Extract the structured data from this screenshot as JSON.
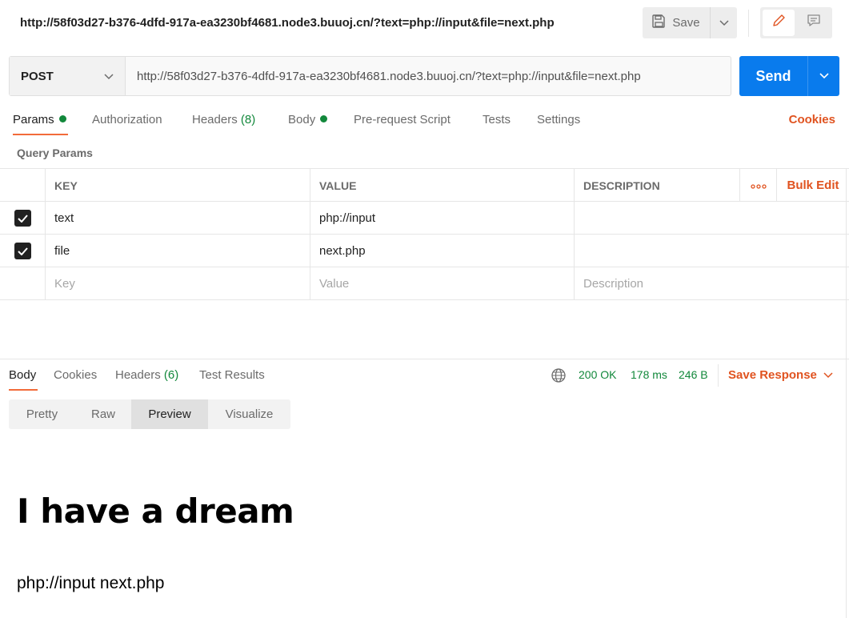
{
  "title_bar": {
    "url": "http://58f03d27-b376-4dfd-917a-ea3230bf4681.node3.buuoj.cn/?text=php://input&file=next.php",
    "save_label": "Save",
    "icons": [
      "save-icon",
      "chevron-down-icon",
      "pencil-icon",
      "comment-icon"
    ]
  },
  "request": {
    "method": "POST",
    "url": "http://58f03d27-b376-4dfd-917a-ea3230bf4681.node3.buuoj.cn/?text=php://input&file=next.php",
    "send_label": "Send"
  },
  "request_tabs": {
    "params": "Params",
    "authorization": "Authorization",
    "headers": "Headers",
    "headers_count": "(8)",
    "body": "Body",
    "pre_request": "Pre-request Script",
    "tests": "Tests",
    "settings": "Settings",
    "cookies": "Cookies"
  },
  "query_params": {
    "label": "Query Params",
    "columns": {
      "key": "KEY",
      "value": "VALUE",
      "description": "DESCRIPTION",
      "bulk_edit": "Bulk Edit"
    },
    "rows": [
      {
        "checked": true,
        "key": "text",
        "value": "php://input",
        "description": ""
      },
      {
        "checked": true,
        "key": "file",
        "value": "next.php",
        "description": ""
      }
    ],
    "placeholders": {
      "key": "Key",
      "value": "Value",
      "description": "Description"
    }
  },
  "response": {
    "tabs": {
      "body": "Body",
      "cookies": "Cookies",
      "headers": "Headers",
      "headers_count": "(6)",
      "test_results": "Test Results"
    },
    "status": "200 OK",
    "time": "178 ms",
    "size": "246 B",
    "save_response": "Save Response",
    "format_tabs": [
      "Pretty",
      "Raw",
      "Preview",
      "Visualize"
    ],
    "active_format": "Preview",
    "preview": {
      "heading": "I have a dream",
      "text": "php://input next.php"
    }
  },
  "colors": {
    "accent_orange": "#e05320",
    "send_blue": "#097bed",
    "status_green": "#12883b"
  }
}
